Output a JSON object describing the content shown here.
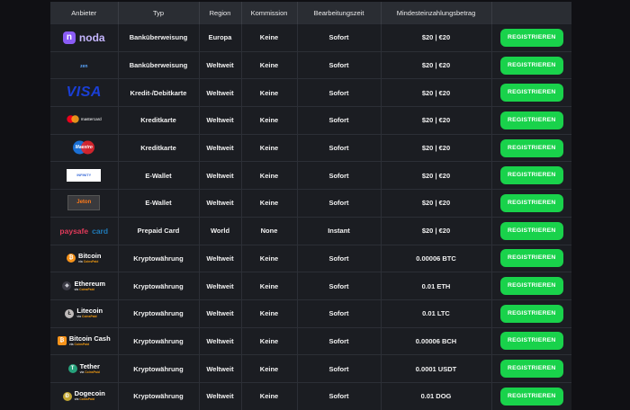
{
  "table": {
    "headers": [
      "Anbieter",
      "Typ",
      "Region",
      "Kommission",
      "Bearbeitungszeit",
      "Mindesteinzahlungsbetrag",
      ""
    ],
    "button_label": "REGISTRIEREN",
    "rows": [
      {
        "provider": "noda",
        "type": "Banküberweisung",
        "region": "Europa",
        "commission": "Keine",
        "time": "Sofort",
        "min": "$20 | €20"
      },
      {
        "provider": "zen",
        "type": "Banküberweisung",
        "region": "Weltweit",
        "commission": "Keine",
        "time": "Sofort",
        "min": "$20 | €20"
      },
      {
        "provider": "VISA",
        "type": "Kredit-/Debitkarte",
        "region": "Weltweit",
        "commission": "Keine",
        "time": "Sofort",
        "min": "$20 | €20"
      },
      {
        "provider": "mastercard",
        "type": "Kreditkarte",
        "region": "Weltweit",
        "commission": "Keine",
        "time": "Sofort",
        "min": "$20 | €20"
      },
      {
        "provider": "Maestro",
        "type": "Kreditkarte",
        "region": "Weltweit",
        "commission": "Keine",
        "time": "Sofort",
        "min": "$20 | €20"
      },
      {
        "provider": "INFINITY",
        "type": "E-Wallet",
        "region": "Weltweit",
        "commission": "Keine",
        "time": "Sofort",
        "min": "$20 | €20"
      },
      {
        "provider": "Jeton",
        "type": "E-Wallet",
        "region": "Weltweit",
        "commission": "Keine",
        "time": "Sofort",
        "min": "$20 | €20"
      },
      {
        "provider": "paysafecard",
        "type": "Prepaid Card",
        "region": "World",
        "commission": "None",
        "time": "Instant",
        "min": "$20 | €20"
      },
      {
        "provider": "Bitcoin",
        "type": "Kryptowährung",
        "region": "Weltweit",
        "commission": "Keine",
        "time": "Sofort",
        "min": "0.00006 BTC"
      },
      {
        "provider": "Ethereum",
        "type": "Kryptowährung",
        "region": "Weltweit",
        "commission": "Keine",
        "time": "Sofort",
        "min": "0.01 ETH"
      },
      {
        "provider": "Litecoin",
        "type": "Kryptowährung",
        "region": "Weltweit",
        "commission": "Keine",
        "time": "Sofort",
        "min": "0.01 LTC"
      },
      {
        "provider": "Bitcoin Cash",
        "type": "Kryptowährung",
        "region": "Weltweit",
        "commission": "Keine",
        "time": "Sofort",
        "min": "0.00006 BCH"
      },
      {
        "provider": "Tether",
        "type": "Kryptowährung",
        "region": "Weltweit",
        "commission": "Keine",
        "time": "Sofort",
        "min": "0.0001 USDT"
      },
      {
        "provider": "Dogecoin",
        "type": "Kryptowährung",
        "region": "Weltweit",
        "commission": "Keine",
        "time": "Sofort",
        "min": "0.01 DOG"
      }
    ]
  },
  "logos": {
    "noda_letter": "n",
    "zen_text": "zen",
    "visa_text": "VISA",
    "mastercard_text": "mastercard",
    "maestro_text": "Maestro",
    "infinity_text": "INFINITY",
    "jeton_text": "Jeton",
    "paysafe_text": "paysafe",
    "paysafe_text2": "card",
    "crypto_sub_prefix": "via",
    "crypto_sub_brand": "CoinsPaid",
    "btc_glyph": "₿",
    "eth_glyph": "◆",
    "ltc_glyph": "Ł",
    "bch_glyph": "₿",
    "usdt_glyph": "T",
    "doge_glyph": "Ð"
  },
  "colors": {
    "accent_green": "#19d24b",
    "header_bg": "#2a2d33",
    "row_bg": "#1b1d22",
    "page_bg": "#101014"
  }
}
